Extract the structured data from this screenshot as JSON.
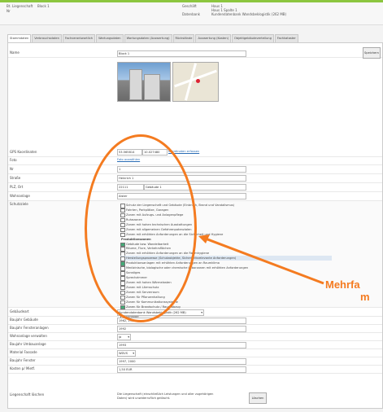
{
  "header": {
    "left_label": "Bt. Liegenschaft",
    "left_value": "Block 1",
    "left_label2": "Nr",
    "right_label": "Geschäft",
    "right_value": "Haus 1",
    "right_value2": "Haus 1 Spalte 1",
    "right_label2": "Datenbank",
    "right_value3": "Kundendatenbank Wandsbeklogistik (262 MB)"
  },
  "tabs": [
    "Stammdaten",
    "Verbrauchsdaten",
    "Fachverantwortlich",
    "Wartungsdaten",
    "Wartungsdaten (Auswertung)",
    "Rückstände",
    "Auswertung (Kosten)",
    "Objektgebäudeverteilung",
    "Fachkataster"
  ],
  "fields": {
    "name_label": "Name",
    "name_value": "Block 1",
    "gps_label": "GPS Koordinaten",
    "gps_lat": "53.565814",
    "gps_lon": "10.027480",
    "gps_link": "Koordinaten erfassen",
    "foto_label": "Foto",
    "foto_link": "Foto auswählen",
    "nr_label": "Nr",
    "nr_value": "1",
    "strasse_label": "Straße",
    "strasse_value": "Heinrich 1",
    "plz_label": "PLZ, Ort",
    "plz_value": "22111",
    "ort_value": "Gebäude 1",
    "wohnanlage_label": "Wohnanlage",
    "wohnanlage_value": "Alster",
    "schutzziele_label": "Schutzziele",
    "gebaeudeart_label": "Gebäudeart",
    "gebaeudeart_value": "Kundendatenbank Wandsbeklogistik (262 MB)",
    "baujahr_label": "Baujahr Gebäude",
    "baujahr_value": "1962, 1965",
    "fenster_label": "Baujahr Fensteranlagen",
    "fenster_value": "1992",
    "wohnanlage_art_label": "Wohnanlage verwalten",
    "wohnanlage_art_value": "ja",
    "umbau_label": "Baujahr Umbauanlage",
    "umbau_value": "1993",
    "material_label": "Material Fassade",
    "material_value": "WDVS",
    "baujahr_fenster_label": "Baujahr Fenster",
    "baujahr_fenster_value": "1997, 2000",
    "kosten_label": "Kosten p/ Mietf.",
    "kosten_value": "1,50 EUR",
    "liegenschaft_label": "Liegenschaft löschen",
    "note": "Die Liegenschaft (einschließlich Leistungen und aller zugehörigen Daten) wird unwiderruflich gelöscht.",
    "delete_button": "Löschen",
    "save_button": "Speichern"
  },
  "checkboxes": [
    {
      "label": "Schutz der Liegenschaft und Gebäude (Einbruch, Brand und Vandalismus)",
      "checked": false,
      "head": false
    },
    {
      "label": "Fahrten, Parkplätze, Garagen",
      "checked": false,
      "head": false
    },
    {
      "label": "Zonen mit Aufzugs- und Anlagenpflege",
      "checked": false,
      "head": false
    },
    {
      "label": "Ruhezonen",
      "checked": false,
      "head": false
    },
    {
      "label": "Zonen mit hohen technischen Ausstattungen",
      "checked": false,
      "head": false
    },
    {
      "label": "Zonen mit allgemeinen Gefahrenpotenzialen",
      "checked": false,
      "head": false
    },
    {
      "label": "Zonen mit erhöhten Anforderungen an die Sicherheit und Hygiene",
      "checked": false,
      "head": false
    },
    {
      "label": "Produktionszonen",
      "checked": false,
      "head": true
    },
    {
      "label": "Gebäude bzw. Wandelbarkeit",
      "checked": true,
      "head": false
    },
    {
      "label": "Räume, Flure, Verkehrsflächen",
      "checked": false,
      "head": false
    },
    {
      "label": "Zonen mit erhöhten Anforderungen an die Raumhygiene",
      "checked": false,
      "head": false
    },
    {
      "label": "Herstellungsprozesse (Schutzobjekte, Sicherheitsrelevante Anforderungen)",
      "checked": false,
      "head": false
    },
    {
      "label": "Produktionsanlagen mit erhöhten Anforderungen an Raumklima",
      "checked": true,
      "head": false
    },
    {
      "label": "Medizinische, biologische oder chemische Laborzonen mit erhöhten Anforderungen",
      "checked": false,
      "head": false
    },
    {
      "label": "Sonstiges",
      "checked": false,
      "head": false
    },
    {
      "label": "Sprechzimmer",
      "checked": false,
      "head": false
    },
    {
      "label": "Zonen mit hohen Wärmelasten",
      "checked": false,
      "head": false
    },
    {
      "label": "Zonen mit Lärmschutz",
      "checked": false,
      "head": false
    },
    {
      "label": "Zonen mit Serverraum",
      "checked": false,
      "head": false
    },
    {
      "label": "Zonen für Pflanzenhaltung",
      "checked": false,
      "head": false
    },
    {
      "label": "Zonen für Kommunikationssysteme",
      "checked": false,
      "head": false
    },
    {
      "label": "Zonen für Brandschutz / Rauchabzug",
      "checked": true,
      "head": false
    },
    {
      "label": "Zonen mit gewerblicher Wohnnutzung",
      "checked": false,
      "head": false
    },
    {
      "label": "Sonstige",
      "checked": false,
      "head": false
    }
  ],
  "annotation": {
    "line1": "Mehrfa",
    "line2": "m",
    "color": "#f47b20"
  }
}
